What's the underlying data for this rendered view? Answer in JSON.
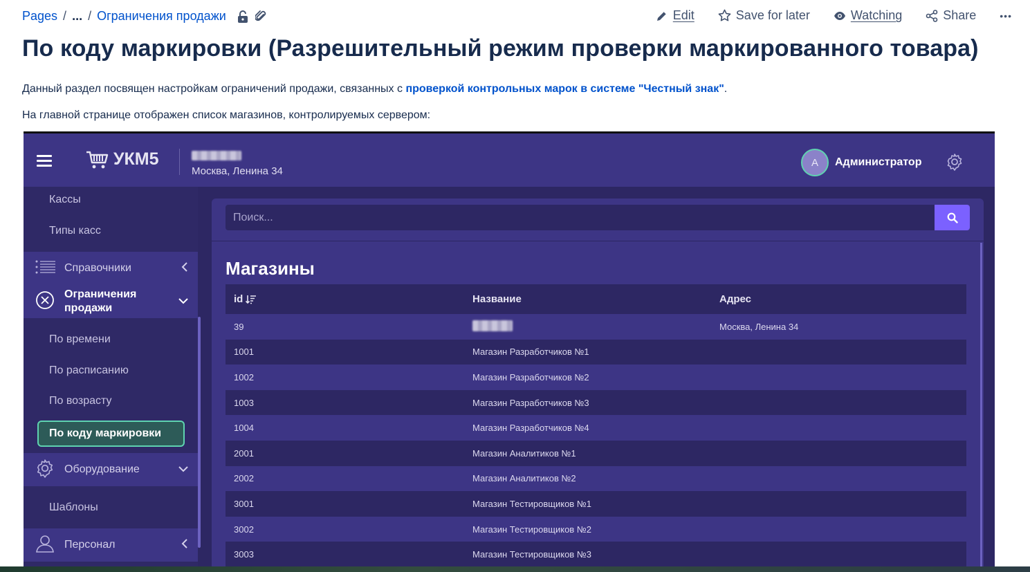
{
  "breadcrumb": {
    "root": "Pages",
    "ellipsis": "...",
    "current": "Ограничения продажи"
  },
  "actions": {
    "edit": "Edit",
    "save_for_later": "Save for later",
    "watching": "Watching",
    "share": "Share",
    "more": "•••"
  },
  "page": {
    "title": "По коду маркировки (Разрешительный режим проверки маркированного товара)",
    "intro_before": "Данный раздел посвящен настройкам ограничений продажи, связанных с ",
    "intro_link": "проверкой контрольных марок в системе \"Честный знак\"",
    "intro_after": ".",
    "list_intro": "На главной странице отображен список магазинов, контролируемых сервером:"
  },
  "app": {
    "logo": "УКМ5",
    "store_address": "Москва, Ленина 34",
    "user": {
      "initial": "A",
      "name": "Администратор"
    },
    "sidebar": {
      "item_kassy": "Кассы",
      "item_kass_types": "Типы касс",
      "group_directories": "Справочники",
      "group_restrictions_line1": "Ограничения",
      "group_restrictions_line2": "продажи",
      "item_by_time": "По времени",
      "item_by_schedule": "По расписанию",
      "item_by_age": "По возрасту",
      "item_by_code": "По коду маркировки",
      "group_equipment": "Оборудование",
      "item_templates": "Шаблоны",
      "group_personnel": "Персонал"
    },
    "search": {
      "placeholder": "Поиск..."
    },
    "section_title": "Магазины",
    "table": {
      "headers": {
        "id": "id",
        "name": "Название",
        "address": "Адрес"
      },
      "rows": [
        {
          "id": "39",
          "name": "",
          "address": "Москва, Ленина 34"
        },
        {
          "id": "1001",
          "name": "Магазин Разработчиков №1",
          "address": ""
        },
        {
          "id": "1002",
          "name": "Магазин Разработчиков №2",
          "address": ""
        },
        {
          "id": "1003",
          "name": "Магазин Разработчиков №3",
          "address": ""
        },
        {
          "id": "1004",
          "name": "Магазин Разработчиков №4",
          "address": ""
        },
        {
          "id": "2001",
          "name": "Магазин Аналитиков №1",
          "address": ""
        },
        {
          "id": "2002",
          "name": "Магазин Аналитиков №2",
          "address": ""
        },
        {
          "id": "3001",
          "name": "Магазин Тестировщиков №1",
          "address": ""
        },
        {
          "id": "3002",
          "name": "Магазин Тестировщиков №2",
          "address": ""
        },
        {
          "id": "3003",
          "name": "Магазин Тестировщиков №3",
          "address": ""
        }
      ]
    }
  },
  "colors": {
    "link": "#0052cc",
    "app_header": "#3d3585",
    "app_bg": "#2d2763",
    "accent": "#7b61ff",
    "active_border": "#5fd3b0"
  }
}
